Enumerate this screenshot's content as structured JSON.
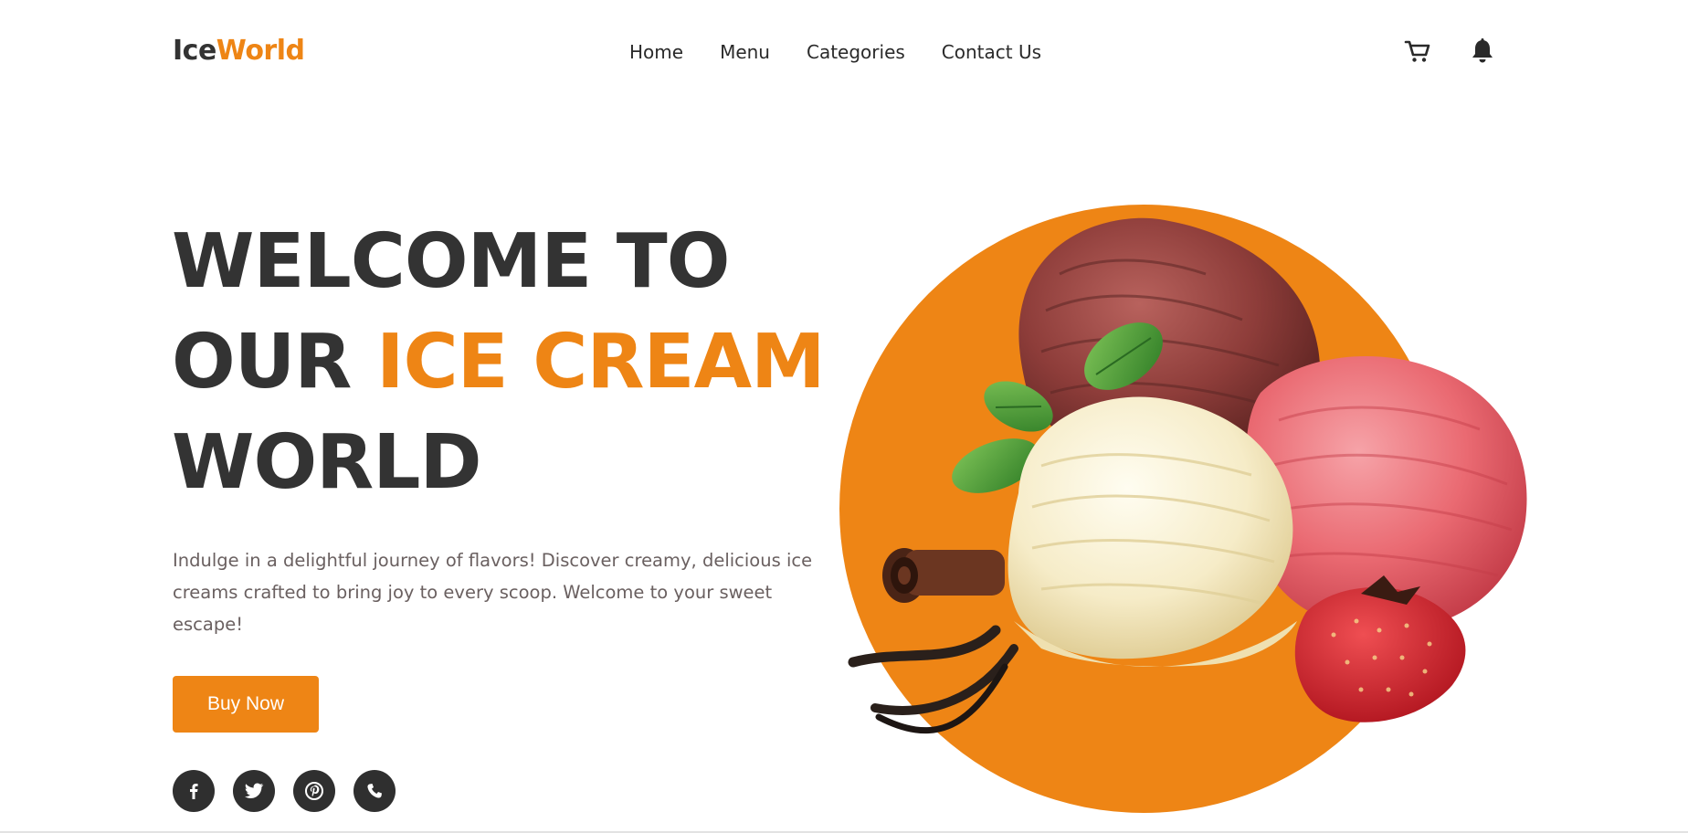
{
  "brand": {
    "part1": "Ice",
    "part2": "World",
    "accent_color": "#ee8515",
    "text_color": "#333333"
  },
  "nav": {
    "links": [
      {
        "label": "Home"
      },
      {
        "label": "Menu"
      },
      {
        "label": "Categories"
      },
      {
        "label": "Contact Us"
      }
    ],
    "icons": [
      "cart-icon",
      "bell-icon"
    ]
  },
  "hero": {
    "title_line1": "WELCOME TO",
    "title_line2_plain": "OUR ",
    "title_line2_accent": "ICE CREAM",
    "title_line3": "WORLD",
    "description": "Indulge in a delightful journey of flavors! Discover creamy, delicious ice creams crafted to bring joy to every scoop. Welcome to your sweet escape!",
    "cta_label": "Buy Now"
  },
  "socials": [
    "facebook-icon",
    "twitter-icon",
    "pinterest-icon",
    "phone-icon"
  ]
}
